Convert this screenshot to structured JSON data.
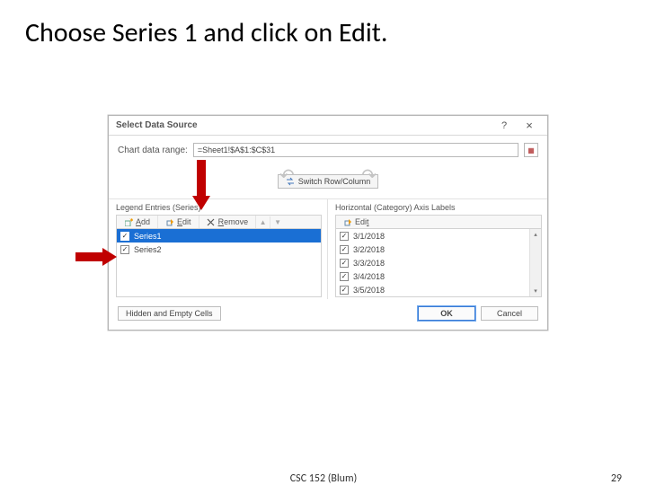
{
  "slide": {
    "title": "Choose Series 1 and click on Edit.",
    "footer_center": "CSC 152 (Blum)",
    "footer_right": "29"
  },
  "dialog": {
    "title": "Select Data Source",
    "help": "?",
    "close": "×",
    "chart_range_label": "Chart data range:",
    "chart_range_value": "=Sheet1!$A$1:$C$31",
    "switch_label": "Switch Row/Column",
    "sections": {
      "left_header": "Legend Entries (Series)",
      "right_header": "Horizontal (Category) Axis Labels"
    },
    "toolbar": {
      "add": "Add",
      "edit": "Edit",
      "remove": "Remove",
      "edit_right": "Edit"
    },
    "series": [
      {
        "label": "Series1",
        "checked": true,
        "selected": true
      },
      {
        "label": "Series2",
        "checked": true,
        "selected": false
      }
    ],
    "axis_labels": [
      "3/1/2018",
      "3/2/2018",
      "3/3/2018",
      "3/4/2018",
      "3/5/2018"
    ],
    "hidden_cells": "Hidden and Empty Cells",
    "ok": "OK",
    "cancel": "Cancel"
  }
}
